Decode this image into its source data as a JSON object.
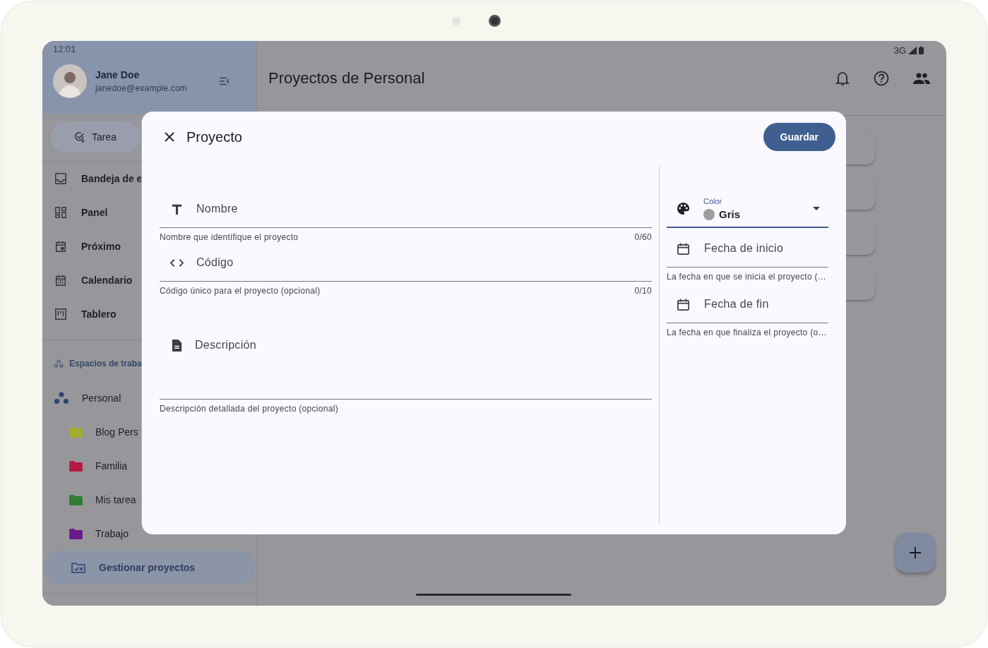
{
  "status_bar": {
    "time": "12:01",
    "network": "3G"
  },
  "user": {
    "name": "Jane Doe",
    "email": "janedoe@example.com"
  },
  "sidebar": {
    "new_task_button": "Tarea",
    "items": [
      {
        "kind": "inbox",
        "label": "Bandeja de e",
        "selected": false
      },
      {
        "kind": "dashboard",
        "label": "Panel",
        "selected": false
      },
      {
        "kind": "upcoming",
        "label": "Próximo",
        "selected": false
      },
      {
        "kind": "calendar",
        "label": "Calendario",
        "selected": false
      },
      {
        "kind": "board",
        "label": "Tablero",
        "selected": false
      }
    ],
    "section": "Espacios de traba",
    "workspace": "Personal",
    "projects": [
      {
        "label": "Blog Pers",
        "color": "#a4ad2c"
      },
      {
        "label": "Familia",
        "color": "#b51a45"
      },
      {
        "label": "Mis tarea",
        "color": "#2e7d32"
      },
      {
        "label": "Trabajo",
        "color": "#6a1b8a"
      }
    ],
    "manage": {
      "label": "Gestionar proyectos",
      "selected": true
    }
  },
  "main": {
    "title": "Proyectos de Personal"
  },
  "dialog": {
    "title": "Proyecto",
    "save_button": "Guardar",
    "fields": [
      {
        "kind": "name",
        "placeholder": "Nombre",
        "helper": "Nombre que identifique el proyecto",
        "counter": "0/60"
      },
      {
        "kind": "code",
        "placeholder": "Código",
        "helper": "Código único para el proyecto (opcional)",
        "counter": "0/10"
      },
      {
        "kind": "description",
        "placeholder": "Descripción",
        "helper": "Descripción detallada del proyecto (opcional)"
      }
    ],
    "side_fields": [
      {
        "kind": "select",
        "label": "Color",
        "value": "Gris",
        "color": "#9e9e9e"
      },
      {
        "kind": "date",
        "placeholder": "Fecha de inicio",
        "helper": "La fecha en que se inicia el proyecto (…"
      },
      {
        "kind": "date",
        "placeholder": "Fecha de fin",
        "helper": "La fecha en que finaliza el proyecto (o…"
      }
    ]
  }
}
